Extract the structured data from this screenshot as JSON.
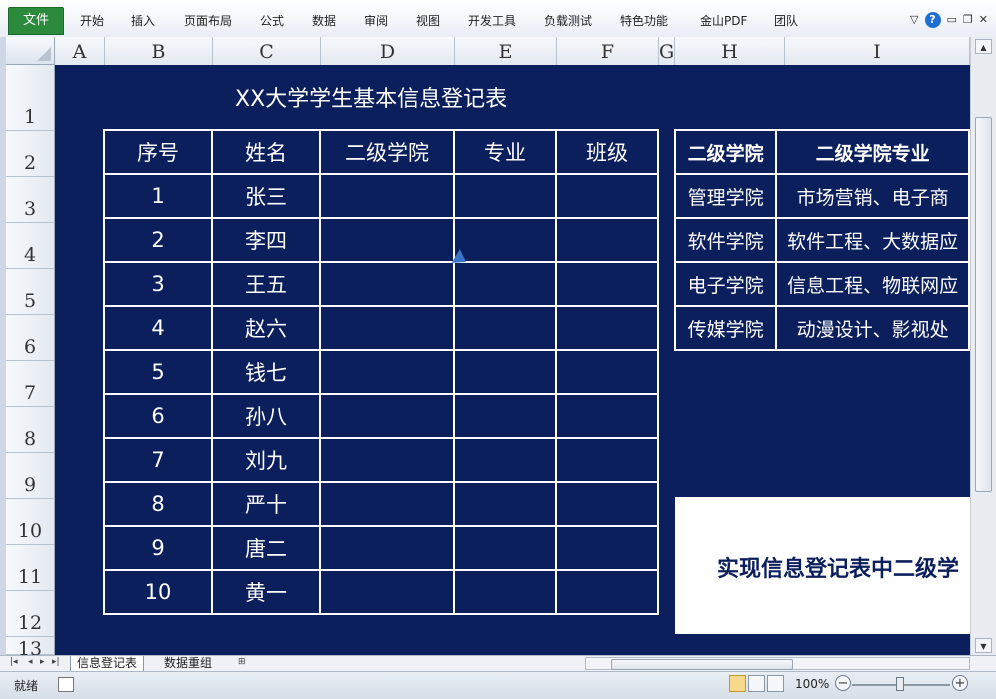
{
  "ribbon": {
    "file_tab": "文件",
    "tabs": [
      "开始",
      "插入",
      "页面布局",
      "公式",
      "数据",
      "审阅",
      "视图",
      "开发工具",
      "负载测试",
      "特色功能",
      "金山PDF",
      "团队"
    ]
  },
  "columns": [
    "A",
    "B",
    "C",
    "D",
    "E",
    "F",
    "G",
    "H",
    "I"
  ],
  "rows": [
    "1",
    "2",
    "3",
    "4",
    "5",
    "6",
    "7",
    "8",
    "9",
    "10",
    "11",
    "12",
    "13"
  ],
  "sheet": {
    "title": "XX大学学生基本信息登记表",
    "headers": [
      "序号",
      "姓名",
      "二级学院",
      "专业",
      "班级"
    ],
    "students": [
      {
        "no": "1",
        "name": "张三"
      },
      {
        "no": "2",
        "name": "李四"
      },
      {
        "no": "3",
        "name": "王五"
      },
      {
        "no": "4",
        "name": "赵六"
      },
      {
        "no": "5",
        "name": "钱七"
      },
      {
        "no": "6",
        "name": "孙八"
      },
      {
        "no": "7",
        "name": "刘九"
      },
      {
        "no": "8",
        "name": "严十"
      },
      {
        "no": "9",
        "name": "唐二"
      },
      {
        "no": "10",
        "name": "黄一"
      }
    ],
    "side_headers": [
      "二级学院",
      "二级学院专业"
    ],
    "colleges": [
      {
        "college": "管理学院",
        "majors": "市场营销、电子商"
      },
      {
        "college": "软件学院",
        "majors": "软件工程、大数据应"
      },
      {
        "college": "电子学院",
        "majors": "信息工程、物联网应"
      },
      {
        "college": "传媒学院",
        "majors": "动漫设计、影视处"
      }
    ],
    "note": "实现信息登记表中二级学"
  },
  "sheet_tabs": [
    "信息登记表",
    "数据重组"
  ],
  "status": {
    "ready": "就绪",
    "zoom": "100%"
  },
  "colors": {
    "sheet_bg": "#0b1f5c",
    "file_tab": "#2c8a3c"
  }
}
